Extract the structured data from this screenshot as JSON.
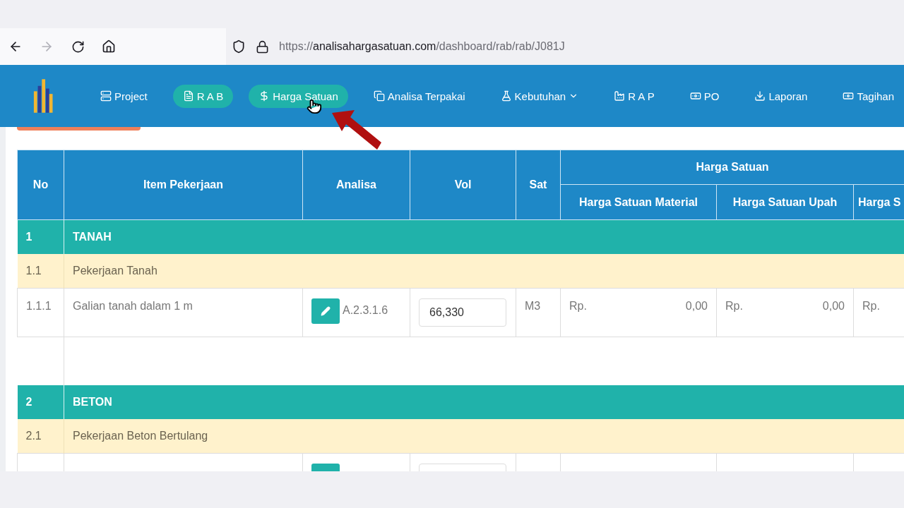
{
  "browser": {
    "back_enabled": true,
    "forward_enabled": false,
    "url": {
      "scheme": "https://",
      "host": "analisahargasatuan.com",
      "path": "/dashboard/rab/rab/J081J"
    }
  },
  "nav": {
    "items": [
      {
        "label": "Project",
        "selected": false,
        "dropdown": false
      },
      {
        "label": "R A B",
        "selected": true,
        "dropdown": false
      },
      {
        "label": "Harga Satuan",
        "selected": true,
        "dropdown": false
      },
      {
        "label": "Analisa Terpakai",
        "selected": false,
        "dropdown": false
      },
      {
        "label": "Kebutuhan",
        "selected": false,
        "dropdown": true
      },
      {
        "label": "R A P",
        "selected": false,
        "dropdown": false
      },
      {
        "label": "PO",
        "selected": false,
        "dropdown": false
      },
      {
        "label": "Laporan",
        "selected": false,
        "dropdown": false
      },
      {
        "label": "Tagihan",
        "selected": false,
        "dropdown": false
      }
    ]
  },
  "table": {
    "columns": [
      "No",
      "Item Pekerjaan",
      "Analisa",
      "Vol",
      "Sat"
    ],
    "group_header": "Harga Satuan",
    "sub_columns": [
      "Harga Satuan Material",
      "Harga Satuan Upah",
      "Harga S"
    ],
    "rows": [
      {
        "kind": "group",
        "no": "1",
        "name": "TANAH"
      },
      {
        "kind": "subgroup",
        "no": "1.1",
        "name": "Pekerjaan Tanah"
      },
      {
        "kind": "item",
        "no": "1.1.1",
        "name": "Galian tanah dalam 1 m",
        "analisa": "A.2.3.1.6",
        "vol": "66,330",
        "sat": "M3",
        "prices": [
          {
            "currency": "Rp.",
            "value": "0,00"
          },
          {
            "currency": "Rp.",
            "value": "0,00"
          },
          {
            "currency": "Rp."
          }
        ]
      },
      {
        "kind": "spacer"
      },
      {
        "kind": "group",
        "no": "2",
        "name": "BETON"
      },
      {
        "kind": "subgroup",
        "no": "2.1",
        "name": "Pekerjaan Beton Bertulang"
      },
      {
        "kind": "cut_item"
      }
    ]
  }
}
